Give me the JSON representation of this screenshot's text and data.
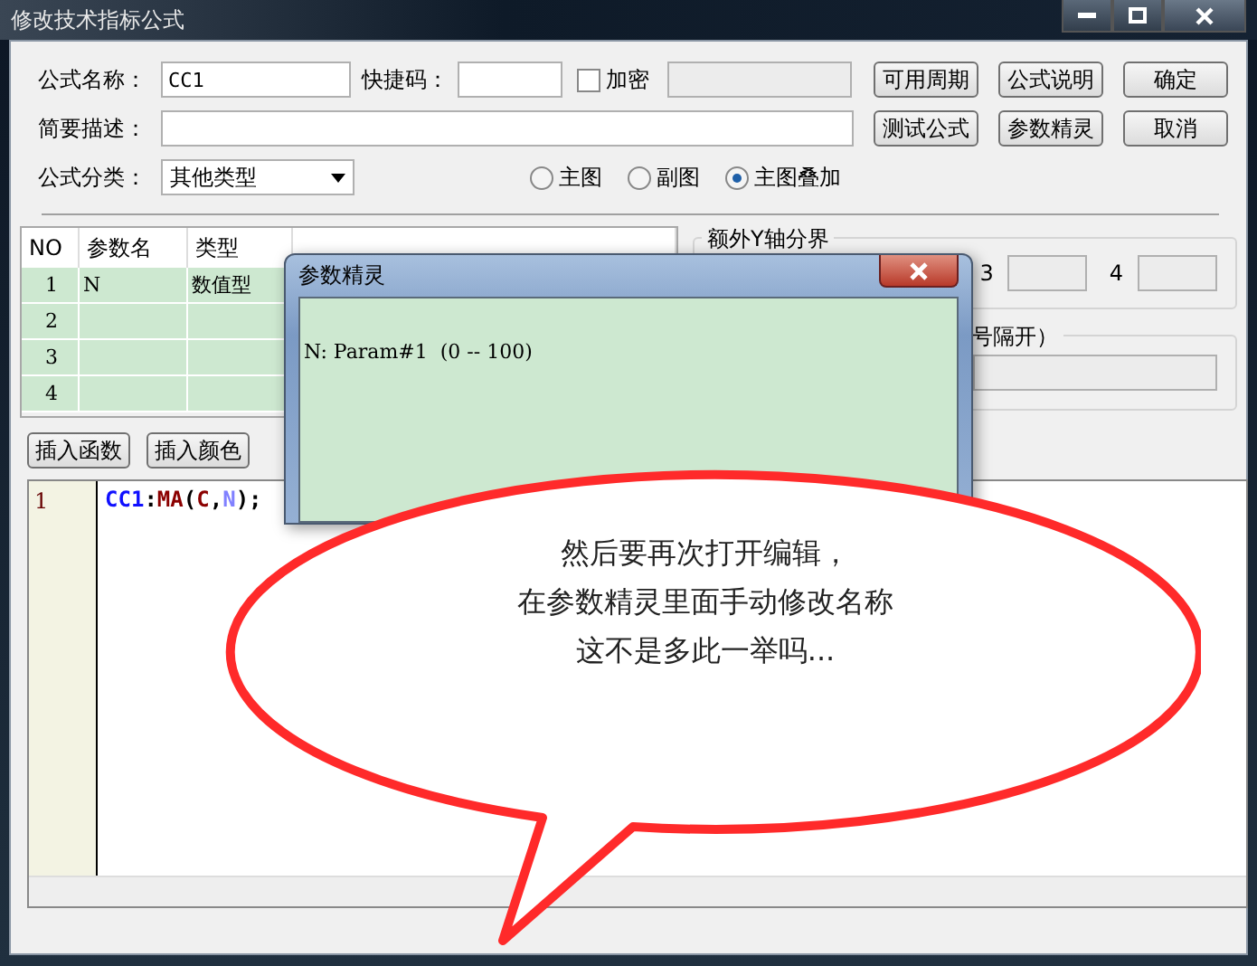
{
  "window": {
    "title": "修改技术指标公式"
  },
  "form": {
    "name_label": "公式名称：",
    "name_value": "CC1",
    "shortcut_label": "快捷码：",
    "encrypt": {
      "label": "加密",
      "checked": false
    },
    "description_label": "简要描述：",
    "category_label": "公式分类：",
    "category_value": "其他类型",
    "chart_options": [
      {
        "label": "主图",
        "selected": false
      },
      {
        "label": "副图",
        "selected": false
      },
      {
        "label": "主图叠加",
        "selected": true
      }
    ]
  },
  "side_buttons": [
    "可用周期",
    "公式说明",
    "确定",
    "测试公式",
    "参数精灵",
    "取消"
  ],
  "params_table": {
    "columns": [
      "NO",
      "参数名",
      "类型"
    ],
    "rows": [
      {
        "no": "1",
        "name": "N",
        "type": "数值型"
      },
      {
        "no": "2"
      },
      {
        "no": "3"
      },
      {
        "no": "4"
      }
    ]
  },
  "y_axis_group": {
    "title": "额外Y轴分界",
    "fields": [
      {
        "label": "3"
      },
      {
        "label": "4"
      }
    ]
  },
  "separator_group": {
    "title": "号隔开）"
  },
  "insert_buttons": [
    "插入函数",
    "插入颜色"
  ],
  "editor": {
    "line_numbers": [
      "1"
    ],
    "tokens": [
      {
        "text": "CC1",
        "kind": "name"
      },
      {
        "text": ":",
        "kind": "punct"
      },
      {
        "text": "MA",
        "kind": "func"
      },
      {
        "text": "(",
        "kind": "punct"
      },
      {
        "text": "C",
        "kind": "func"
      },
      {
        "text": ",",
        "kind": "punct"
      },
      {
        "text": "N",
        "kind": "param"
      },
      {
        "text": ");",
        "kind": "punct"
      }
    ]
  },
  "param_wizard": {
    "title": "参数精灵",
    "text": "N: Param#1  (0 -- 100)"
  },
  "callout": {
    "lines": [
      "然后要再次打开编辑，",
      "在参数精灵里面手动修改名称",
      "这不是多此一举吗..."
    ]
  }
}
